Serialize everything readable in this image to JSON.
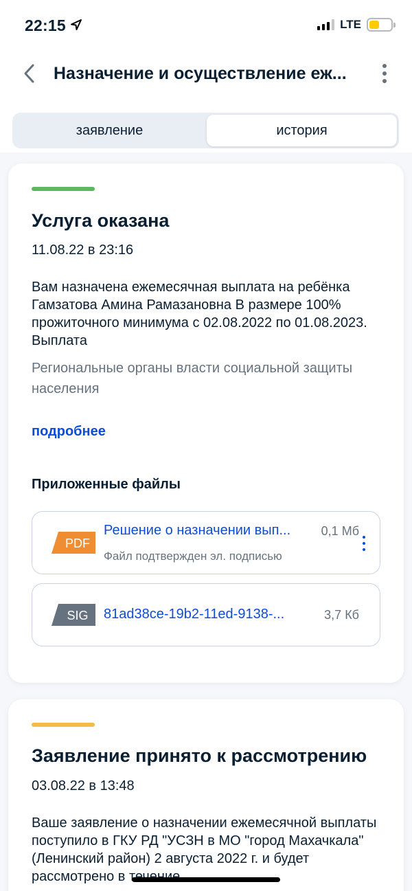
{
  "status_bar": {
    "time": "22:15",
    "network": "LTE",
    "icons": [
      "location-arrow-icon",
      "signal-icon",
      "battery-icon"
    ],
    "battery_color": "#ffcc00"
  },
  "header": {
    "title": "Назначение и осуществление еж...",
    "icons": [
      "chevron-left-icon",
      "more-vertical-icon"
    ]
  },
  "tabs": [
    {
      "label": "заявление",
      "selected": false
    },
    {
      "label": "история",
      "selected": true
    }
  ],
  "events": [
    {
      "accent_color": "#5cb85c",
      "title": "Услуга оказана",
      "date": "11.08.22 в 23:16",
      "text": "Вам назначена ежемесячная выплата на ребёнка Гамзатова Амина Рамазановна В размере 100% прожиточного минимума с 02.08.2022 по 01.08.2023. Выплата",
      "org": "Региональные органы власти социальной защиты населения",
      "more_label": "подробнее",
      "files_title": "Приложенные файлы",
      "files": [
        {
          "badge": "PDF",
          "badge_color": "#ee8d32",
          "name": "Решение о назначении вып...",
          "size": "0,1 Мб",
          "subtitle": "Файл подтвержден эл. подписью"
        },
        {
          "badge": "SIG",
          "badge_color": "#66727f",
          "name": "81ad38ce-19b2-11ed-9138-...",
          "size": "3,7 Кб"
        }
      ]
    },
    {
      "accent_color": "#f2bb4a",
      "title": "Заявление принято к рассмотрению",
      "date": "03.08.22 в 13:48",
      "text": "Ваше заявление о назначении ежемесячной выплаты поступило в ГКУ РД \"УСЗН в МО \"город Махачкала\" (Ленинский район) 2 августа 2022 г. и будет рассмотрено в течение"
    }
  ],
  "colors": {
    "link": "#0d4cd3",
    "text_primary": "#0b1f33",
    "text_secondary": "#66727f",
    "background": "#f5f7fa"
  }
}
